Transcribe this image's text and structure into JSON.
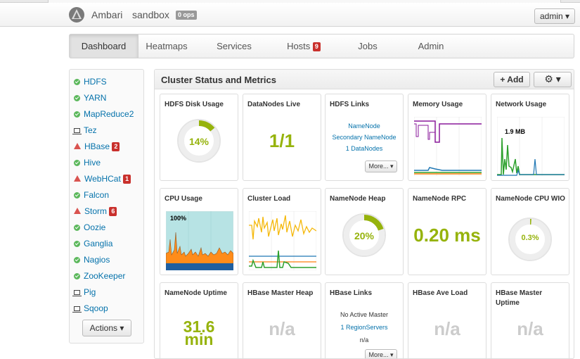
{
  "navbar": {
    "brand": "Ambari",
    "cluster": "sandbox",
    "ops_badge": "0 ops",
    "user_menu": "admin ▾"
  },
  "tabs": [
    {
      "label": "Dashboard",
      "active": true
    },
    {
      "label": "Heatmaps"
    },
    {
      "label": "Services"
    },
    {
      "label": "Hosts",
      "badge": "9"
    },
    {
      "label": "Jobs"
    },
    {
      "label": "Admin"
    }
  ],
  "sidebar": {
    "services": [
      {
        "name": "HDFS",
        "status": "ok"
      },
      {
        "name": "YARN",
        "status": "ok"
      },
      {
        "name": "MapReduce2",
        "status": "ok"
      },
      {
        "name": "Tez",
        "status": "client"
      },
      {
        "name": "HBase",
        "status": "alert",
        "badge": "2"
      },
      {
        "name": "Hive",
        "status": "ok"
      },
      {
        "name": "WebHCat",
        "status": "alert",
        "badge": "1"
      },
      {
        "name": "Falcon",
        "status": "ok"
      },
      {
        "name": "Storm",
        "status": "alert",
        "badge": "6"
      },
      {
        "name": "Oozie",
        "status": "ok"
      },
      {
        "name": "Ganglia",
        "status": "ok"
      },
      {
        "name": "Nagios",
        "status": "ok"
      },
      {
        "name": "ZooKeeper",
        "status": "ok"
      },
      {
        "name": "Pig",
        "status": "client"
      },
      {
        "name": "Sqoop",
        "status": "client"
      }
    ],
    "actions_label": "Actions ▾"
  },
  "main": {
    "title": "Cluster Status and Metrics",
    "add_label": "+ Add",
    "gear_label": "⚙ ▾"
  },
  "widgets": {
    "hdfs_disk": {
      "title": "HDFS Disk Usage",
      "value": "14%",
      "fraction": 0.14
    },
    "datanodes": {
      "title": "DataNodes Live",
      "value": "1/1"
    },
    "hdfs_links": {
      "title": "HDFS Links",
      "links": [
        "NameNode",
        "Secondary NameNode",
        "1 DataNodes"
      ],
      "more": "More... ▾"
    },
    "memory": {
      "title": "Memory Usage"
    },
    "network": {
      "title": "Network Usage",
      "label": "1.9 MB"
    },
    "cpu": {
      "title": "CPU Usage",
      "label": "100%"
    },
    "cluster_load": {
      "title": "Cluster Load"
    },
    "nn_heap": {
      "title": "NameNode Heap",
      "value": "20%",
      "fraction": 0.2
    },
    "nn_rpc": {
      "title": "NameNode RPC",
      "value": "0.20 ms"
    },
    "nn_cpu": {
      "title": "NameNode CPU WIO",
      "value": "0.3%",
      "fraction": 0.003
    },
    "nn_uptime": {
      "title": "NameNode Uptime",
      "value_num": "31.6",
      "value_unit": "min"
    },
    "hbase_heap": {
      "title": "HBase Master Heap",
      "value": "n/a"
    },
    "hbase_links": {
      "title": "HBase Links",
      "line1": "No Active Master",
      "link": "1 RegionServers",
      "line3": "n/a",
      "more": "More... ▾"
    },
    "hbase_load": {
      "title": "HBase Ave Load",
      "value": "n/a"
    },
    "hbase_uptime": {
      "title": "HBase Master Uptime",
      "value": "n/a"
    }
  },
  "colors": {
    "accent_green": "#96b30c",
    "link_blue": "#0572ab",
    "alert_red": "#d9534f",
    "ok_green": "#5cb85c"
  }
}
